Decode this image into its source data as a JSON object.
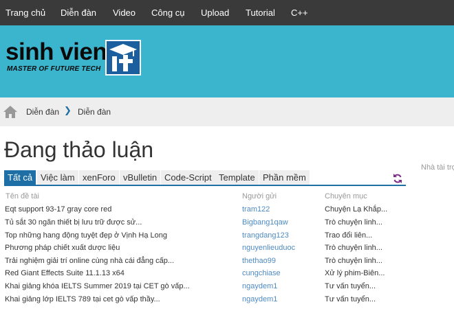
{
  "nav": {
    "items": [
      "Trang chủ",
      "Diễn đàn",
      "Video",
      "Công cụ",
      "Upload",
      "Tutorial",
      "C++"
    ]
  },
  "banner": {
    "logo_text": "sinh vien",
    "logo_tagline": "MASTER OF FUTURE TECH",
    "logo_icon": "graduation-cap-it-icon"
  },
  "breadcrumb": {
    "items": [
      "Diễn đàn",
      "Diễn đàn"
    ],
    "home_icon": "home-icon",
    "separator_icon": "chevron-right-icon"
  },
  "page": {
    "title": "Đang thảo luận",
    "side_note": "Nhà tài trợ"
  },
  "tabs": [
    "Tất cả",
    "Việc làm",
    "xenForo",
    "vBulletin",
    "Code-Script",
    "Template",
    "Phần mềm"
  ],
  "active_tab": "Tất cả",
  "table": {
    "headers": [
      "Tên đề tài",
      "Người gửi",
      "Chuyên mục"
    ],
    "rows": [
      {
        "title": "Eqt support 93-17 gray core red",
        "user": "tram122",
        "category": "Chuyện Lạ Khắp..."
      },
      {
        "title": "Tủ sắt 30 ngăn thiết bị lưu trữ được sử...",
        "user": "Bigbang1qaw",
        "category": "Trò chuyện linh..."
      },
      {
        "title": "Top những hang động tuyệt đẹp ở Vịnh Hạ Long",
        "user": "trangdang123",
        "category": "Trao đổi liên..."
      },
      {
        "title": "Phương pháp chiết xuất dược liệu",
        "user": "nguyenlieuduoc",
        "category": "Trò chuyện linh..."
      },
      {
        "title": "Trải nghiệm giải trí online cùng nhà cái đẳng cấp...",
        "user": "thethao99",
        "category": "Trò chuyện linh..."
      },
      {
        "title": "Red Giant Effects Suite 11.1.13 x64",
        "user": "cungchiase",
        "category": "Xử lý phim-Biên..."
      },
      {
        "title": "Khai giảng khóa IELTS Summer 2019 tại CET gò vấp...",
        "user": "ngaydem1",
        "category": "Tư vấn tuyển..."
      },
      {
        "title": "Khai giảng lớp IELTS 789 tại cet gò vấp thầy...",
        "user": "ngaydem1",
        "category": "Tư vấn tuyển..."
      }
    ]
  },
  "colors": {
    "nav_bg": "#3a3a3a",
    "banner_bg": "#3bb4ce",
    "accent": "#1d6fa5",
    "link": "#4e8ac2"
  }
}
